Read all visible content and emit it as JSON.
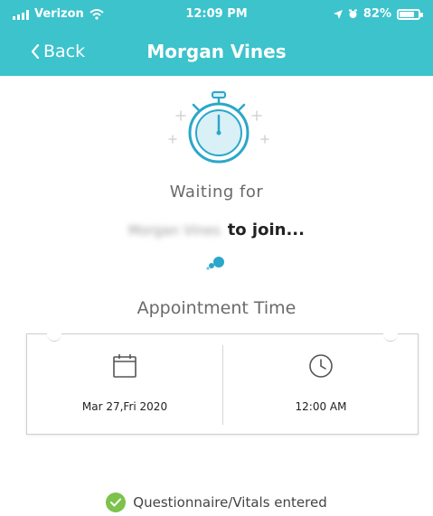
{
  "status_bar": {
    "carrier": "Verizon",
    "time": "12:09 PM",
    "battery": "82%",
    "battery_level": 0.82
  },
  "nav": {
    "back_label": "Back",
    "title": "Morgan Vines"
  },
  "waiting": {
    "line1": "Waiting for",
    "participant_name": "Morgan Vines",
    "join_text": "to join..."
  },
  "appointment": {
    "label": "Appointment Time",
    "date": "Mar 27,Fri 2020",
    "time": "12:00 AM"
  },
  "status": {
    "text": "Questionnaire/Vitals entered"
  },
  "colors": {
    "header": "#3cc3cc",
    "accent": "#2aa7c9",
    "success": "#7cc24c"
  }
}
